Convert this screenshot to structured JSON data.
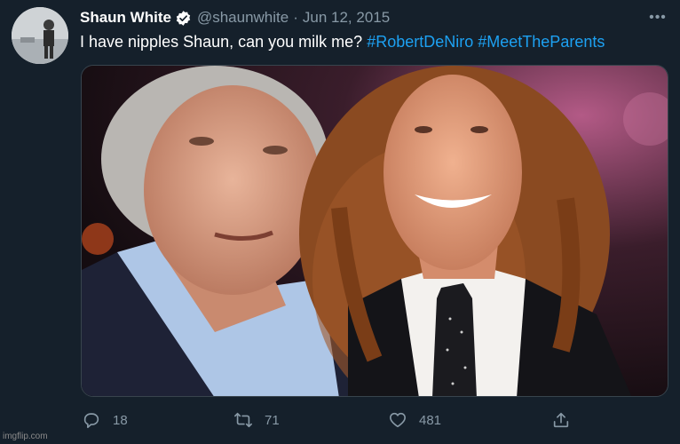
{
  "tweet": {
    "author_name": "Shaun White",
    "handle": "@shaunwhite",
    "separator": "·",
    "date": "Jun 12, 2015",
    "text_main": "I have nipples Shaun, can you milk me? ",
    "hashtags": [
      "#RobertDeNiro",
      "#MeetTheParents"
    ],
    "more_label": "•••"
  },
  "actions": {
    "reply_count": "18",
    "retweet_count": "71",
    "like_count": "481"
  },
  "icons": {
    "verified": "verified-badge-icon",
    "reply": "reply-icon",
    "retweet": "retweet-icon",
    "like": "heart-icon",
    "share": "share-icon",
    "more": "more-icon"
  },
  "colors": {
    "background": "#15202b",
    "text": "#ffffff",
    "secondary": "#8899a6",
    "link": "#1da1f2"
  },
  "watermark": "imgflip.com"
}
